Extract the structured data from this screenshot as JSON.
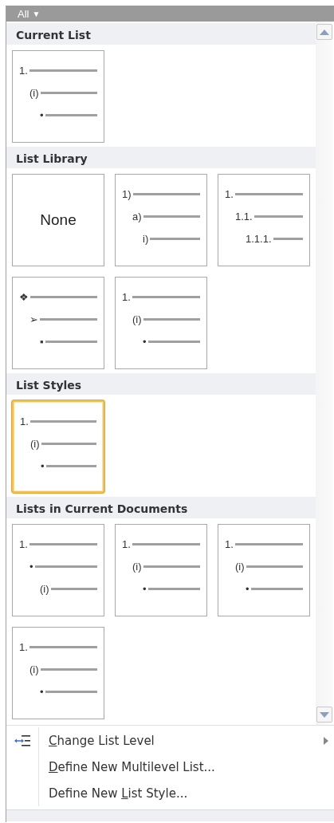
{
  "filter": {
    "label": "All",
    "arrow": "▼"
  },
  "sections": [
    {
      "title": "Current List",
      "tiles": [
        {
          "kind": "list",
          "selected": false,
          "rows": [
            {
              "marker": "1.",
              "children": [
                {
                  "marker": "(i)",
                  "children": [
                    {
                      "marker": "•"
                    }
                  ]
                }
              ]
            }
          ]
        }
      ]
    },
    {
      "title": "List Library",
      "tiles": [
        {
          "kind": "none",
          "selected": false,
          "label": "None"
        },
        {
          "kind": "list",
          "selected": false,
          "rows": [
            {
              "marker": "1)",
              "children": [
                {
                  "marker": "a)",
                  "children": [
                    {
                      "marker": "i)"
                    }
                  ]
                }
              ]
            }
          ]
        },
        {
          "kind": "list",
          "selected": false,
          "rows": [
            {
              "marker": "1.",
              "children": [
                {
                  "marker": "1.1.",
                  "children": [
                    {
                      "marker": "1.1.1."
                    }
                  ]
                }
              ]
            }
          ]
        },
        {
          "kind": "list",
          "selected": false,
          "rows": [
            {
              "marker": "❖",
              "children": [
                {
                  "marker": "➢",
                  "children": [
                    {
                      "marker": "▪"
                    }
                  ]
                }
              ]
            }
          ]
        },
        {
          "kind": "list",
          "selected": false,
          "rows": [
            {
              "marker": "1.",
              "children": [
                {
                  "marker": "(i)",
                  "children": [
                    {
                      "marker": "•"
                    }
                  ]
                }
              ]
            }
          ]
        }
      ]
    },
    {
      "title": "List Styles",
      "tiles": [
        {
          "kind": "list",
          "selected": true,
          "rows": [
            {
              "marker": "1.",
              "children": [
                {
                  "marker": "(i)",
                  "children": [
                    {
                      "marker": "•"
                    }
                  ]
                }
              ]
            }
          ]
        }
      ]
    },
    {
      "title": "Lists in Current Documents",
      "tiles": [
        {
          "kind": "list",
          "selected": false,
          "rows": [
            {
              "marker": "1.",
              "children": [
                {
                  "marker": "•",
                  "children": [
                    {
                      "marker": "(i)"
                    }
                  ]
                }
              ]
            }
          ]
        },
        {
          "kind": "list",
          "selected": false,
          "rows": [
            {
              "marker": "1.",
              "children": [
                {
                  "marker": "(i)",
                  "children": [
                    {
                      "marker": "•"
                    }
                  ]
                }
              ]
            }
          ]
        },
        {
          "kind": "list",
          "selected": false,
          "rows": [
            {
              "marker": "1.",
              "children": [
                {
                  "marker": "(i)",
                  "children": [
                    {
                      "marker": "•"
                    }
                  ]
                }
              ]
            }
          ]
        },
        {
          "kind": "list",
          "selected": false,
          "rows": [
            {
              "marker": "1.",
              "children": [
                {
                  "marker": "(i)",
                  "children": [
                    {
                      "marker": "•"
                    }
                  ]
                }
              ]
            }
          ]
        }
      ]
    }
  ],
  "menu": [
    {
      "label": {
        "key": "C",
        "after": "hange List Level"
      },
      "icon": true,
      "submenu": true
    },
    {
      "label": {
        "key": "D",
        "after": "efine New Multilevel List..."
      },
      "icon": false,
      "submenu": false
    },
    {
      "label": {
        "before": "Define New ",
        "key": "L",
        "after": "ist Style..."
      },
      "icon": false,
      "submenu": false
    }
  ]
}
